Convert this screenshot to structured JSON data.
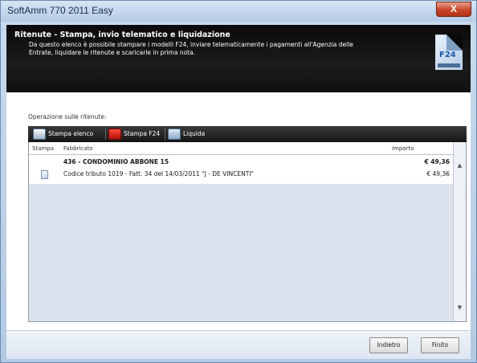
{
  "window": {
    "title": "SoftAmm 770 2011 Easy",
    "close_label": "X"
  },
  "header": {
    "title": "Ritenute - Stampa, invio telematico e liquidazione",
    "description": "Da questo elenco è possibile stampare i modelli F24, inviare telematicamente i pagamenti all'Agenzia delle Entrate, liquidare le ritenute e scaricarle in prima nota.",
    "badge": "F24"
  },
  "content": {
    "section_label": "Operazione sulle ritenute:",
    "toolbar": {
      "print_list": "Stampa elenco",
      "print_f24": "Stampa F24",
      "liquidate": "Liquida"
    },
    "grid": {
      "columns": [
        "Stampa",
        "Fabbricato",
        "Importo"
      ],
      "rows": [
        {
          "type": "group",
          "text": "436 - CONDOMINIO ABBONE 15",
          "amount": "€ 49,36"
        },
        {
          "type": "item",
          "text": "Codice tributo 1019 - Fatt. 34 del 14/03/2011 \"J - DE VINCENTI\"",
          "amount": "€ 49,36"
        }
      ]
    }
  },
  "footer": {
    "back_label": "Indietro",
    "finish_label": "Finito"
  }
}
